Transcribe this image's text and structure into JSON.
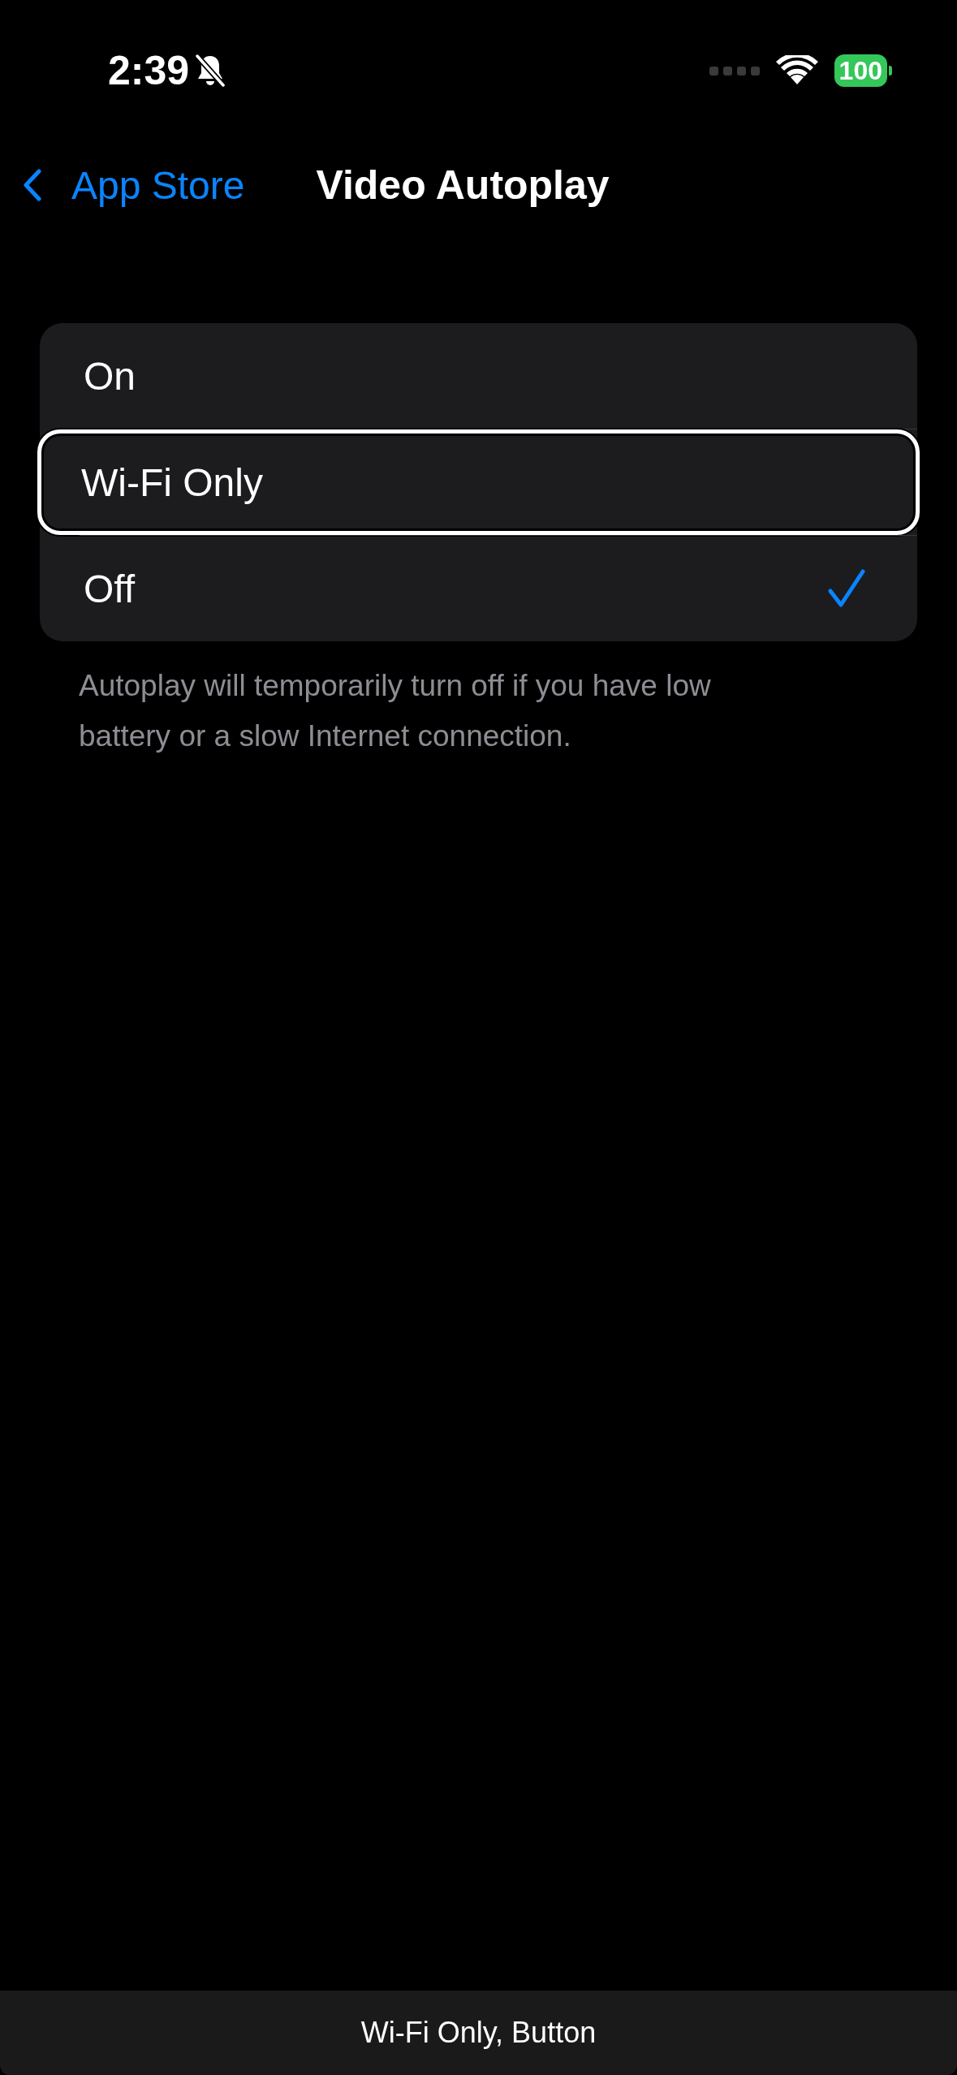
{
  "status_bar": {
    "time": "2:39",
    "silent": true,
    "battery": "100"
  },
  "nav": {
    "back": "App Store",
    "title": "Video Autoplay"
  },
  "options": [
    {
      "label": "On",
      "selected": false,
      "focused": false
    },
    {
      "label": "Wi-Fi Only",
      "selected": false,
      "focused": true
    },
    {
      "label": "Off",
      "selected": true,
      "focused": false
    }
  ],
  "footer": "Autoplay will temporarily turn off if you have low battery or a slow Internet connection.",
  "voiceover_caption": "Wi-Fi Only, Button"
}
